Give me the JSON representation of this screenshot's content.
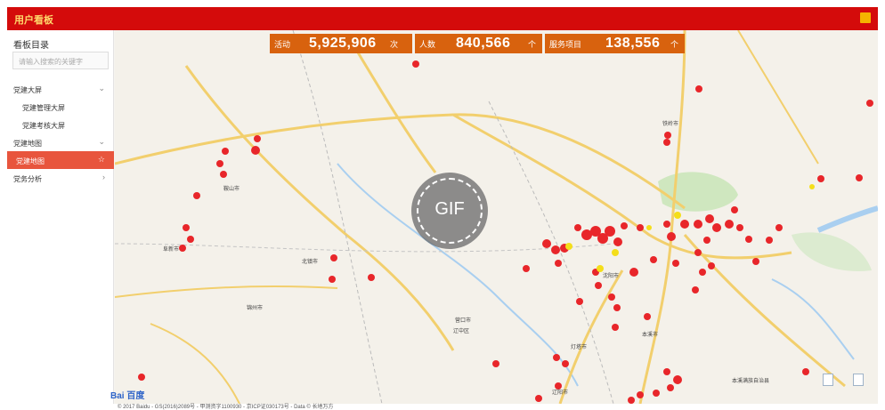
{
  "header": {
    "title": "用户看板"
  },
  "sidebar": {
    "title": "看板目录",
    "search_placeholder": "请输入搜索的关键字",
    "items": [
      {
        "label": "党建大屏",
        "arrow": "⌄"
      },
      {
        "label": "党建管理大屏",
        "arrow": ""
      },
      {
        "label": "党建考核大屏",
        "arrow": ""
      },
      {
        "label": "党建地图",
        "arrow": "⌄"
      },
      {
        "label": "党建地图",
        "arrow": "☆"
      },
      {
        "label": "党务分析",
        "arrow": "›"
      }
    ]
  },
  "stats": [
    {
      "label": "活动",
      "value": "5,925,906",
      "unit": "次"
    },
    {
      "label": "人数",
      "value": "840,566",
      "unit": "个"
    },
    {
      "label": "服务项目",
      "value": "138,556",
      "unit": "个"
    }
  ],
  "overlay": {
    "gif_label": "GIF"
  },
  "map": {
    "logo": "Bai 百度",
    "copyright": "© 2017 Baidu - GS(2016)2089号 - 甲测资字1100930 - 京ICP证030173号 - Data © 长地万方",
    "labels": [
      "铁岭市",
      "沈阳市",
      "本溪市",
      "辽阳市",
      "鞍山市",
      "阜新市",
      "锦州市",
      "营口市",
      "本溪满族自治县",
      "辽中区",
      "灯塔市",
      "北镇市"
    ],
    "colors": {
      "marker_red": "#e8262a",
      "marker_yellow": "#f4de1a",
      "road": "#f2cf6d",
      "water": "#a9cff0",
      "green": "#c9e4b8"
    }
  }
}
